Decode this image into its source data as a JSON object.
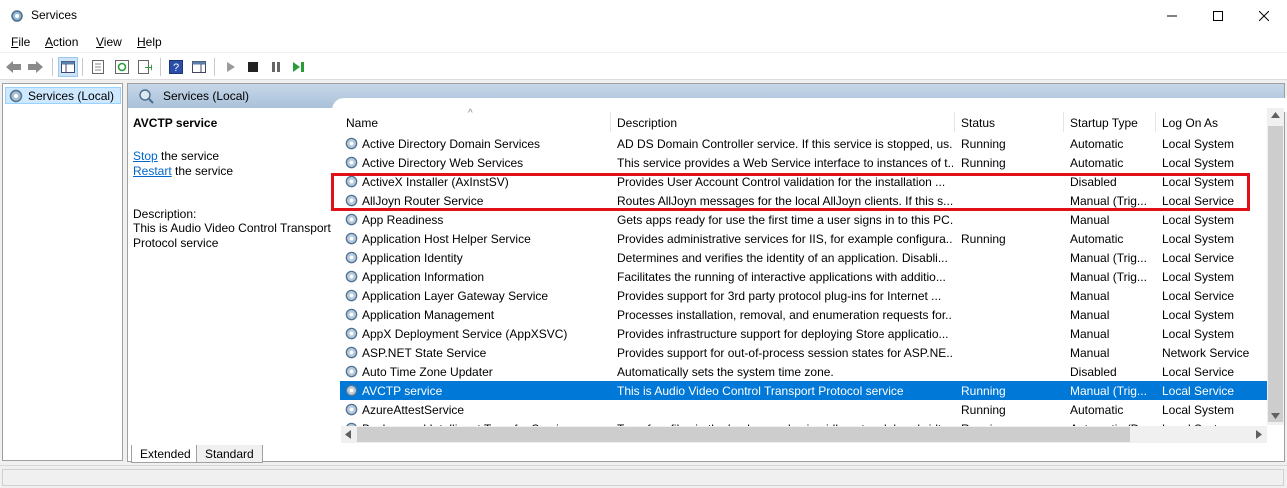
{
  "window": {
    "title": "Services",
    "app_icon": "gear-icon",
    "controls": {
      "minimize": "—",
      "maximize": "☐",
      "close": "✕"
    }
  },
  "menu": [
    {
      "accel": "F",
      "rest": "ile"
    },
    {
      "accel": "A",
      "rest": "ction"
    },
    {
      "accel": "V",
      "rest": "iew"
    },
    {
      "accel": "H",
      "rest": "elp"
    }
  ],
  "toolbar": {
    "back": "◀",
    "forward": "▶",
    "play": "▶",
    "stop": "■",
    "pause": "❚❚",
    "restart": "▶❚",
    "help": "?"
  },
  "tree": {
    "selected": "Services (Local)"
  },
  "panel": {
    "title": "Services (Local)"
  },
  "details": {
    "service_title": "AVCTP service",
    "stop_link": "Stop",
    "stop_rest": " the service",
    "restart_link": "Restart",
    "restart_rest": " the service",
    "desc_label": "Description:",
    "desc_text": "This is Audio Video Control Transport Protocol service"
  },
  "columns": {
    "name": "Name",
    "description": "Description",
    "status": "Status",
    "startup": "Startup Type",
    "logon": "Log On As",
    "sort_indicator": "^"
  },
  "services": [
    {
      "name": "Active Directory Domain Services",
      "desc": "AD DS Domain Controller service. If this service is stopped, us...",
      "status": "Running",
      "startup": "Automatic",
      "logon": "Local System"
    },
    {
      "name": "Active Directory Web Services",
      "desc": "This service provides a Web Service interface to instances of t...",
      "status": "Running",
      "startup": "Automatic",
      "logon": "Local System"
    },
    {
      "name": "ActiveX Installer (AxInstSV)",
      "desc": "Provides User Account Control validation for the installation ...",
      "status": "",
      "startup": "Disabled",
      "logon": "Local System"
    },
    {
      "name": "AllJoyn Router Service",
      "desc": "Routes AllJoyn messages for the local AllJoyn clients. If this s...",
      "status": "",
      "startup": "Manual (Trig...",
      "logon": "Local Service"
    },
    {
      "name": "App Readiness",
      "desc": "Gets apps ready for use the first time a user signs in to this PC...",
      "status": "",
      "startup": "Manual",
      "logon": "Local System"
    },
    {
      "name": "Application Host Helper Service",
      "desc": "Provides administrative services for IIS, for example configura...",
      "status": "Running",
      "startup": "Automatic",
      "logon": "Local System"
    },
    {
      "name": "Application Identity",
      "desc": "Determines and verifies the identity of an application. Disabli...",
      "status": "",
      "startup": "Manual (Trig...",
      "logon": "Local Service"
    },
    {
      "name": "Application Information",
      "desc": "Facilitates the running of interactive applications with additio...",
      "status": "",
      "startup": "Manual (Trig...",
      "logon": "Local System"
    },
    {
      "name": "Application Layer Gateway Service",
      "desc": "Provides support for 3rd party protocol plug-ins for Internet ...",
      "status": "",
      "startup": "Manual",
      "logon": "Local Service"
    },
    {
      "name": "Application Management",
      "desc": "Processes installation, removal, and enumeration requests for...",
      "status": "",
      "startup": "Manual",
      "logon": "Local System"
    },
    {
      "name": "AppX Deployment Service (AppXSVC)",
      "desc": "Provides infrastructure support for deploying Store applicatio...",
      "status": "",
      "startup": "Manual",
      "logon": "Local System"
    },
    {
      "name": "ASP.NET State Service",
      "desc": "Provides support for out-of-process session states for ASP.NE...",
      "status": "",
      "startup": "Manual",
      "logon": "Network Service"
    },
    {
      "name": "Auto Time Zone Updater",
      "desc": "Automatically sets the system time zone.",
      "status": "",
      "startup": "Disabled",
      "logon": "Local Service"
    },
    {
      "name": "AVCTP service",
      "desc": "This is Audio Video Control Transport Protocol service",
      "status": "Running",
      "startup": "Manual (Trig...",
      "logon": "Local Service",
      "selected": true
    },
    {
      "name": "AzureAttestService",
      "desc": "",
      "status": "Running",
      "startup": "Automatic",
      "logon": "Local System"
    },
    {
      "name": "Background Intelligent Transfer Service",
      "desc": "Transfers files in the background using idle network bandwidt...",
      "status": "Running",
      "startup": "Automatic (D...",
      "logon": "Local System"
    }
  ],
  "tabs": [
    "Extended",
    "Standard"
  ],
  "colors": {
    "selection": "#0078d7",
    "highlight_box": "#e3101a",
    "link": "#0066cc"
  }
}
